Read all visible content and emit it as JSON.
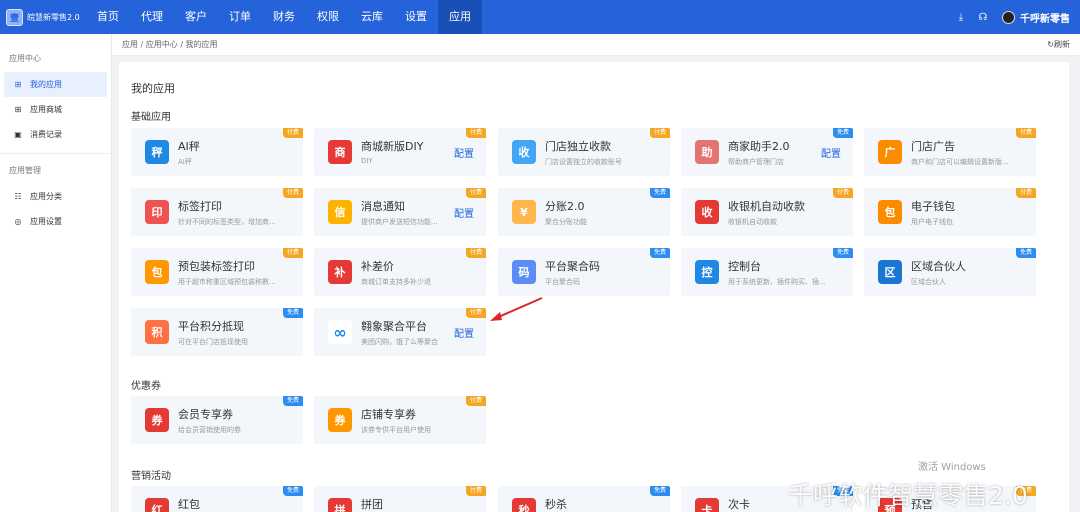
{
  "app": {
    "logo_mark": "壹",
    "logo_text": "皖慧新零售2.0"
  },
  "nav": {
    "items": [
      "首页",
      "代理",
      "客户",
      "订单",
      "财务",
      "权限",
      "云库",
      "设置",
      "应用"
    ],
    "active_index": 8,
    "user_name": "千呼新零售"
  },
  "sidebar": {
    "group1": "应用中心",
    "group1_items": [
      {
        "label": "我的应用",
        "icon": "grid-icon"
      },
      {
        "label": "应用商城",
        "icon": "grid-icon"
      },
      {
        "label": "消费记录",
        "icon": "receipt-icon"
      }
    ],
    "group2": "应用管理",
    "group2_items": [
      {
        "label": "应用分类",
        "icon": "category-icon"
      },
      {
        "label": "应用设置",
        "icon": "settings-icon"
      }
    ]
  },
  "breadcrumb": "应用 / 应用中心 / 我的应用",
  "refresh_label": "刷新",
  "page_title": "我的应用",
  "sections": {
    "basic": "基础应用",
    "coupon": "优惠券",
    "marketing": "营销活动"
  },
  "config_label": "配置",
  "badges": {
    "paid": "付费",
    "free": "免费"
  },
  "cards": [
    {
      "name": "AI秤",
      "desc": "AI秤",
      "badge": "paid",
      "config": false,
      "color": "#1e88e5",
      "glyph": "秤"
    },
    {
      "name": "商城新版DIY",
      "desc": "DIY",
      "badge": "paid",
      "config": true,
      "color": "#e53935",
      "glyph": "商"
    },
    {
      "name": "门店独立收款",
      "desc": "门店设置独立的收款账号",
      "badge": "paid",
      "config": false,
      "color": "#42a5f5",
      "glyph": "收"
    },
    {
      "name": "商家助手2.0",
      "desc": "帮助商户管理门店",
      "badge": "free",
      "config": true,
      "color": "#e57373",
      "glyph": "助"
    },
    {
      "name": "门店广告",
      "desc": "商户和门店可以编辑设置新版...",
      "badge": "paid",
      "config": false,
      "color": "#fb8c00",
      "glyph": "广"
    },
    {
      "name": "标签打印",
      "desc": "针对不同的标签类型，增加商...",
      "badge": "paid",
      "config": false,
      "color": "#ef5350",
      "glyph": "印"
    },
    {
      "name": "消息通知",
      "desc": "提供商户发送短信功能...",
      "badge": "paid",
      "config": true,
      "color": "#ffb300",
      "glyph": "信"
    },
    {
      "name": "分账2.0",
      "desc": "聚合分账功能",
      "badge": "free",
      "config": false,
      "color": "#ffb74d",
      "glyph": "¥"
    },
    {
      "name": "收银机自动收款",
      "desc": "收银机自动收款",
      "badge": "paid",
      "config": false,
      "color": "#e53935",
      "glyph": "收"
    },
    {
      "name": "电子钱包",
      "desc": "用户电子钱包",
      "badge": "paid",
      "config": false,
      "color": "#fb8c00",
      "glyph": "包"
    },
    {
      "name": "预包装标签打印",
      "desc": "用于超市称重区域预包装称數...",
      "badge": "paid",
      "config": false,
      "color": "#ff9800",
      "glyph": "包"
    },
    {
      "name": "补差价",
      "desc": "商城订单支持多补少退",
      "badge": "paid",
      "config": false,
      "color": "#e53935",
      "glyph": "补"
    },
    {
      "name": "平台聚合码",
      "desc": "平台聚合码",
      "badge": "free",
      "config": false,
      "color": "#5c8df6",
      "glyph": "码"
    },
    {
      "name": "控制台",
      "desc": "用于系统更新、插件购买、插...",
      "badge": "free",
      "config": false,
      "color": "#1e88e5",
      "glyph": "控"
    },
    {
      "name": "区域合伙人",
      "desc": "区域合伙人",
      "badge": "free",
      "config": false,
      "color": "#1976d2",
      "glyph": "区"
    },
    {
      "name": "平台积分抵现",
      "desc": "可在平台门店抵现使用",
      "badge": "free",
      "config": false,
      "color": "#ff7043",
      "glyph": "积"
    },
    {
      "name": "翱象聚合平台",
      "desc": "美团闪购，饿了么等聚合",
      "badge": "paid",
      "config": true,
      "color": "#ffffff",
      "glyph": "∞"
    },
    {
      "name": "会员专享券",
      "desc": "给会员营销使用的券",
      "badge": "free",
      "config": false,
      "color": "#e53935",
      "glyph": "券"
    },
    {
      "name": "店铺专享券",
      "desc": "该券专供平台用户使用",
      "badge": "paid",
      "config": false,
      "color": "#ff9800",
      "glyph": "券"
    },
    {
      "name": "红包",
      "desc": "",
      "badge": "free",
      "config": false,
      "color": "#e53935",
      "glyph": "红"
    },
    {
      "name": "拼团",
      "desc": "",
      "badge": "paid",
      "config": false,
      "color": "#e53935",
      "glyph": "拼"
    },
    {
      "name": "秒杀",
      "desc": "",
      "badge": "free",
      "config": false,
      "color": "#e53935",
      "glyph": "秒"
    },
    {
      "name": "次卡",
      "desc": "",
      "badge": "free",
      "config": false,
      "color": "#e53935",
      "glyph": "卡"
    },
    {
      "name": "预售",
      "desc": "",
      "badge": "paid",
      "config": false,
      "color": "#e53935",
      "glyph": "预"
    }
  ],
  "overlay": {
    "activate_windows": "激活 Windows",
    "watermark": "千呼软件智慧零售2.0"
  }
}
